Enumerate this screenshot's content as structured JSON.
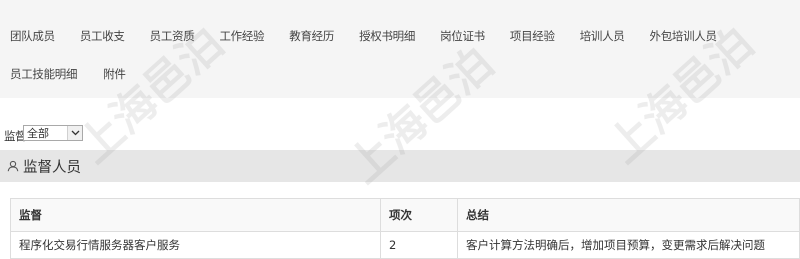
{
  "tabs": {
    "row1": [
      "团队成员",
      "员工收支",
      "员工资质",
      "工作经验",
      "教育经历",
      "授权书明细",
      "岗位证书",
      "项目经验",
      "培训人员",
      "外包培训人员"
    ],
    "row2": [
      "员工技能明细",
      "附件"
    ]
  },
  "filter": {
    "label": "监督",
    "selected": "全部"
  },
  "section": {
    "title": "监督人员",
    "icon": "user-icon"
  },
  "table": {
    "headers": [
      "监督",
      "项次",
      "总结"
    ],
    "rows": [
      [
        "程序化交易行情服务器客户服务",
        "2",
        "客户计算方法明确后，增加项目预算，变更需求后解决问题"
      ]
    ]
  },
  "watermark": "上海邑泊",
  "colors": {
    "tabs_background": "#f5f5f5",
    "section_background": "#e6e6e6",
    "border": "#dddddd"
  }
}
